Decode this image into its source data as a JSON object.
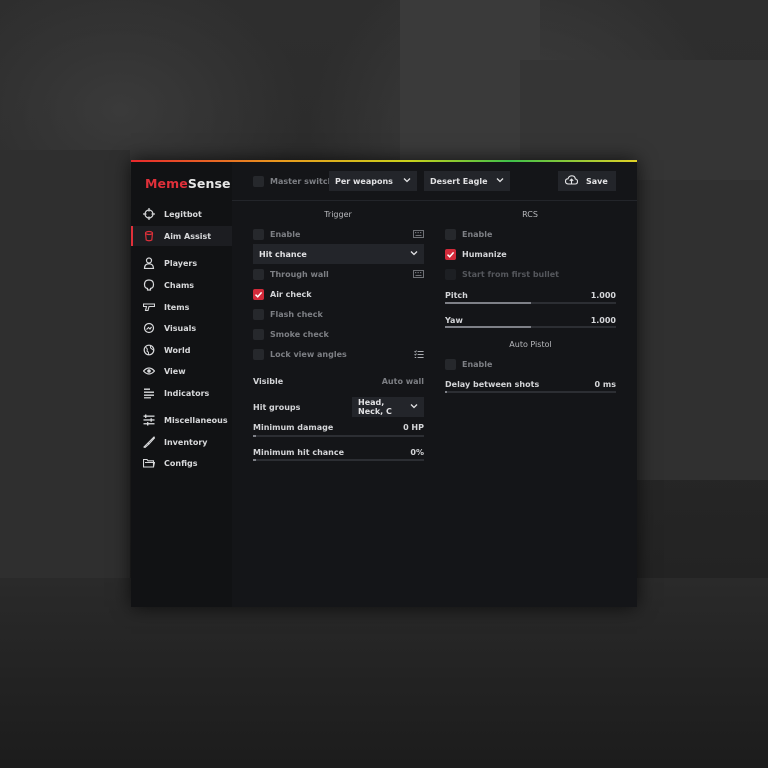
{
  "app": {
    "logo_part1": "Meme",
    "logo_part2": "Sense",
    "accent": "#e0303a"
  },
  "sidebar": {
    "items": [
      {
        "label": "Legitbot",
        "icon": "crosshair-icon"
      },
      {
        "label": "Aim Assist",
        "icon": "bucket-icon",
        "active": true
      },
      {
        "label": "Players",
        "icon": "person-icon"
      },
      {
        "label": "Chams",
        "icon": "head-icon"
      },
      {
        "label": "Items",
        "icon": "gun-icon"
      },
      {
        "label": "Visuals",
        "icon": "visuals-icon"
      },
      {
        "label": "World",
        "icon": "globe-icon"
      },
      {
        "label": "View",
        "icon": "eye-icon"
      },
      {
        "label": "Indicators",
        "icon": "list-icon"
      },
      {
        "label": "Miscellaneous",
        "icon": "sliders-icon"
      },
      {
        "label": "Inventory",
        "icon": "knife-icon"
      },
      {
        "label": "Configs",
        "icon": "folder-icon"
      }
    ]
  },
  "topbar": {
    "master_switch": "Master switch",
    "mode_select": "Per weapons",
    "weapon_select": "Desert Eagle",
    "save_label": "Save"
  },
  "trigger": {
    "heading": "Trigger",
    "enable": "Enable",
    "hit_chance_select": "Hit chance",
    "through_wall": "Through wall",
    "air_check": "Air check",
    "flash_check": "Flash check",
    "smoke_check": "Smoke check",
    "lock_view_angles": "Lock view angles",
    "visible_label": "Visible",
    "visible_value": "Auto wall",
    "hit_groups_label": "Hit groups",
    "hit_groups_value": "Head, Neck, C",
    "min_damage_label": "Minimum damage",
    "min_damage_value": "0 HP",
    "min_damage_fraction": 0.02,
    "min_hit_chance_label": "Minimum hit chance",
    "min_hit_chance_value": "0%",
    "min_hit_chance_fraction": 0.02
  },
  "rcs": {
    "heading": "RCS",
    "enable": "Enable",
    "humanize": "Humanize",
    "start_first_bullet": "Start from first bullet",
    "pitch_label": "Pitch",
    "pitch_value": "1.000",
    "pitch_fraction": 0.5,
    "yaw_label": "Yaw",
    "yaw_value": "1.000",
    "yaw_fraction": 0.5
  },
  "auto_pistol": {
    "heading": "Auto Pistol",
    "enable": "Enable",
    "delay_label": "Delay between shots",
    "delay_value": "0 ms",
    "delay_fraction": 0.01
  }
}
